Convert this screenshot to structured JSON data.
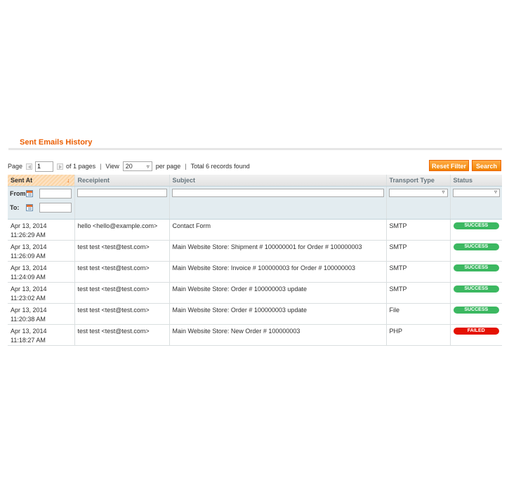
{
  "header": {
    "title": "Sent Emails History"
  },
  "pager": {
    "page_label": "Page",
    "page_value": "1",
    "of_pages": "of 1 pages",
    "view_label": "View",
    "view_value": "20",
    "per_page": "per page",
    "total": "Total 6 records found",
    "sep": "|"
  },
  "actions": {
    "reset_filter": "Reset Filter",
    "search": "Search"
  },
  "columns": [
    "Sent At",
    "Receipient",
    "Subject",
    "Transport Type",
    "Status"
  ],
  "filter": {
    "from_label": "From:",
    "to_label": "To:"
  },
  "rows": [
    {
      "sent_at": "Apr 13, 2014 11:26:29 AM",
      "recipient": "hello <hello@example.com>",
      "subject": "Contact Form",
      "transport": "SMTP",
      "status": "SUCCESS",
      "status_kind": "success"
    },
    {
      "sent_at": "Apr 13, 2014 11:26:09 AM",
      "recipient": "test test <test@test.com>",
      "subject": "Main Website Store: Shipment # 100000001 for Order # 100000003",
      "transport": "SMTP",
      "status": "SUCCESS",
      "status_kind": "success"
    },
    {
      "sent_at": "Apr 13, 2014 11:24:09 AM",
      "recipient": "test test <test@test.com>",
      "subject": "Main Website Store: Invoice # 100000003 for Order # 100000003",
      "transport": "SMTP",
      "status": "SUCCESS",
      "status_kind": "success"
    },
    {
      "sent_at": "Apr 13, 2014 11:23:02 AM",
      "recipient": "test test <test@test.com>",
      "subject": "Main Website Store: Order # 100000003 update",
      "transport": "SMTP",
      "status": "SUCCESS",
      "status_kind": "success"
    },
    {
      "sent_at": "Apr 13, 2014 11:20:38 AM",
      "recipient": "test test <test@test.com>",
      "subject": "Main Website Store: Order # 100000003 update",
      "transport": "File",
      "status": "SUCCESS",
      "status_kind": "success"
    },
    {
      "sent_at": "Apr 13, 2014 11:18:27 AM",
      "recipient": "test test <test@test.com>",
      "subject": "Main Website Store: New Order # 100000003",
      "transport": "PHP",
      "status": "FAILED",
      "status_kind": "failed"
    }
  ],
  "colors": {
    "accent": "#eb5e00",
    "button": "#f18200",
    "success": "#3cb861",
    "failed": "#e41101",
    "filter_bg": "#e3ecf0"
  },
  "icons": [
    "arrow-left-icon",
    "arrow-right-icon",
    "calendar-icon",
    "sort-arrow-down-icon",
    "chevron-down-icon"
  ]
}
